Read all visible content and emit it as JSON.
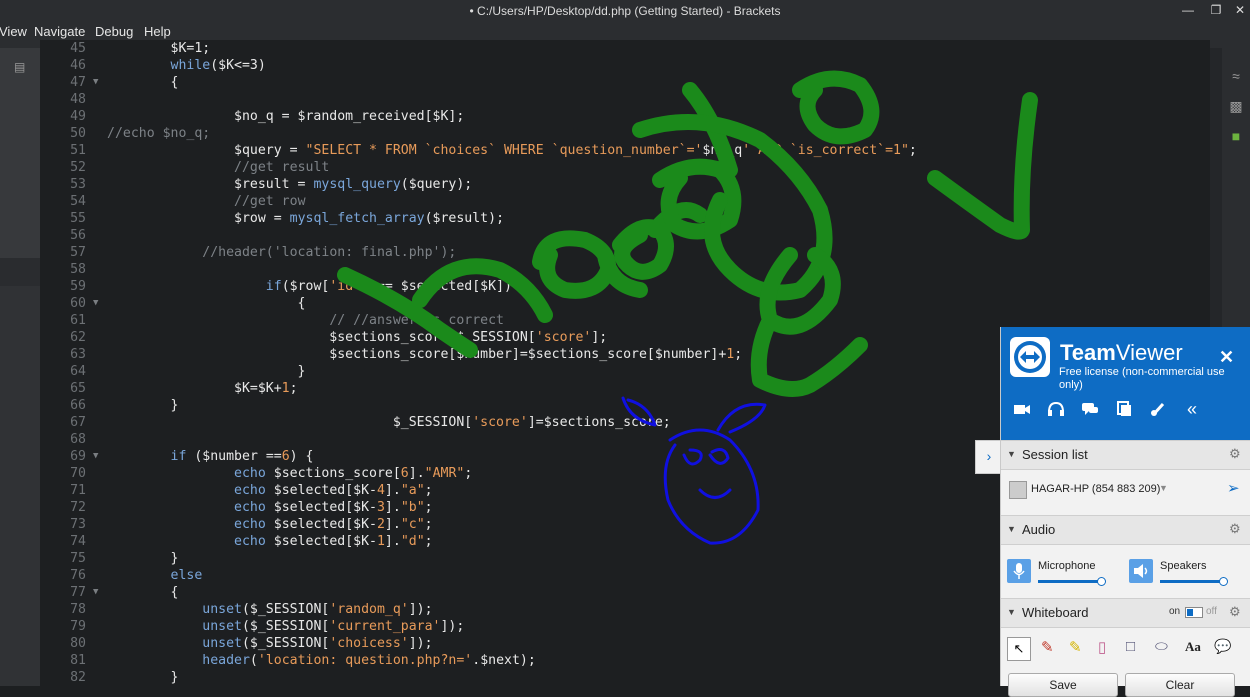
{
  "window": {
    "title": "• C:/Users/HP/Desktop/dd.php (Getting Started) - Brackets"
  },
  "menu": [
    "View",
    "Navigate",
    "Debug",
    "Help"
  ],
  "code_lines": [
    {
      "n": "45",
      "fold": "",
      "html": "<span class=\"var\">$K=1;</span>",
      "indent": "        "
    },
    {
      "n": "46",
      "fold": "",
      "html": "<span class=\"kw\">while</span>($K&lt;=3)",
      "indent": "        "
    },
    {
      "n": "47",
      "fold": "▼",
      "html": "{",
      "indent": "        "
    },
    {
      "n": "48",
      "fold": "",
      "html": "",
      "indent": ""
    },
    {
      "n": "49",
      "fold": "",
      "html": "$no_q = $random_received[$K];",
      "indent": "                "
    },
    {
      "n": "50",
      "fold": "",
      "html": "<span class=\"cm\">//echo $no_q;</span>",
      "indent": ""
    },
    {
      "n": "51",
      "fold": "",
      "html": "$query = <span class=\"str\">\"SELECT * FROM `choices` WHERE `question_number`='</span>$no_q<span class=\"str\">' AND `is_correct`=1\"</span>;",
      "indent": "                "
    },
    {
      "n": "52",
      "fold": "",
      "html": "<span class=\"cm\">//get result</span>",
      "indent": "                "
    },
    {
      "n": "53",
      "fold": "",
      "html": "$result = <span class=\"kw\">mysql_query</span>($query);",
      "indent": "                "
    },
    {
      "n": "54",
      "fold": "",
      "html": "<span class=\"cm\">//get row</span>",
      "indent": "                "
    },
    {
      "n": "55",
      "fold": "",
      "html": "$row = <span class=\"kw\">mysql_fetch_array</span>($result);",
      "indent": "                "
    },
    {
      "n": "56",
      "fold": "",
      "html": "",
      "indent": ""
    },
    {
      "n": "57",
      "fold": "",
      "html": "<span class=\"cm\">//header('location: final.php');</span>",
      "indent": "            "
    },
    {
      "n": "58",
      "fold": "",
      "html": "",
      "indent": ""
    },
    {
      "n": "59",
      "fold": "",
      "html": "<span class=\"kw\">if</span>($row[<span class=\"str\">'id'</span>] == $selected[$K])",
      "indent": "                    "
    },
    {
      "n": "60",
      "fold": "▼",
      "html": "{",
      "indent": "                        "
    },
    {
      "n": "61",
      "fold": "",
      "html": "<span class=\"cm\">// //answer is correct</span>",
      "indent": "                            "
    },
    {
      "n": "62",
      "fold": "",
      "html": "$sections_score=$_SESSION[<span class=\"str\">'score'</span>];",
      "indent": "                            "
    },
    {
      "n": "63",
      "fold": "",
      "html": "$sections_score[$number]=$sections_score[$number]+<span class=\"str\">1</span>;",
      "indent": "                            "
    },
    {
      "n": "64",
      "fold": "",
      "html": "}",
      "indent": "                        "
    },
    {
      "n": "65",
      "fold": "",
      "html": "$K=$K+<span class=\"str\">1</span>;",
      "indent": "                "
    },
    {
      "n": "66",
      "fold": "",
      "html": "}",
      "indent": "        "
    },
    {
      "n": "67",
      "fold": "",
      "html": "$_SESSION[<span class=\"str\">'score'</span>]=$sections_score;",
      "indent": "                                    "
    },
    {
      "n": "68",
      "fold": "",
      "html": "",
      "indent": ""
    },
    {
      "n": "69",
      "fold": "▼",
      "html": "<span class=\"kw\">if</span> ($number ==<span class=\"str\">6</span>) {",
      "indent": "        "
    },
    {
      "n": "70",
      "fold": "",
      "html": "<span class=\"kw\">echo</span> $sections_score[<span class=\"str\">6</span>].<span class=\"str\">\"AMR\"</span>;",
      "indent": "                "
    },
    {
      "n": "71",
      "fold": "",
      "html": "<span class=\"kw\">echo</span> $selected[$K-<span class=\"str\">4</span>].<span class=\"str\">\"a\"</span>;",
      "indent": "                "
    },
    {
      "n": "72",
      "fold": "",
      "html": "<span class=\"kw\">echo</span> $selected[$K-<span class=\"str\">3</span>].<span class=\"str\">\"b\"</span>;",
      "indent": "                "
    },
    {
      "n": "73",
      "fold": "",
      "html": "<span class=\"kw\">echo</span> $selected[$K-<span class=\"str\">2</span>].<span class=\"str\">\"c\"</span>;",
      "indent": "                "
    },
    {
      "n": "74",
      "fold": "",
      "html": "<span class=\"kw\">echo</span> $selected[$K-<span class=\"str\">1</span>].<span class=\"str\">\"d\"</span>;",
      "indent": "                "
    },
    {
      "n": "75",
      "fold": "",
      "html": "}",
      "indent": "        "
    },
    {
      "n": "76",
      "fold": "",
      "html": "<span class=\"kw\">else</span>",
      "indent": "        "
    },
    {
      "n": "77",
      "fold": "▼",
      "html": "{",
      "indent": "        "
    },
    {
      "n": "78",
      "fold": "",
      "html": "<span class=\"kw\">unset</span>($_SESSION[<span class=\"str\">'random_q'</span>]);",
      "indent": "            "
    },
    {
      "n": "79",
      "fold": "",
      "html": "<span class=\"kw\">unset</span>($_SESSION[<span class=\"str\">'current_para'</span>]);",
      "indent": "            "
    },
    {
      "n": "80",
      "fold": "",
      "html": "<span class=\"kw\">unset</span>($_SESSION[<span class=\"str\">'choicess'</span>]);",
      "indent": "            "
    },
    {
      "n": "81",
      "fold": "",
      "html": "<span class=\"kw\">header</span>(<span class=\"str\">'location: question.php?n='</span>.$next);",
      "indent": "            "
    },
    {
      "n": "82",
      "fold": "",
      "html": "}",
      "indent": "        "
    }
  ],
  "teamviewer": {
    "brand_bold": "Team",
    "brand_thin": "Viewer",
    "license": "Free license (non-commercial use only)",
    "session_list_label": "Session list",
    "session_name": "HAGAR-HP (854 883 209)",
    "audio_label": "Audio",
    "microphone_label": "Microphone",
    "speakers_label": "Speakers",
    "whiteboard_label": "Whiteboard",
    "whiteboard_on": "on",
    "whiteboard_off": "off",
    "save_label": "Save",
    "clear_label": "Clear",
    "accent": "#0e6cc4",
    "microphone_level": 0.95,
    "speakers_level": 0.95
  },
  "drawing_colors": {
    "green": "#1b8a1b",
    "blue": "#1010e0"
  }
}
